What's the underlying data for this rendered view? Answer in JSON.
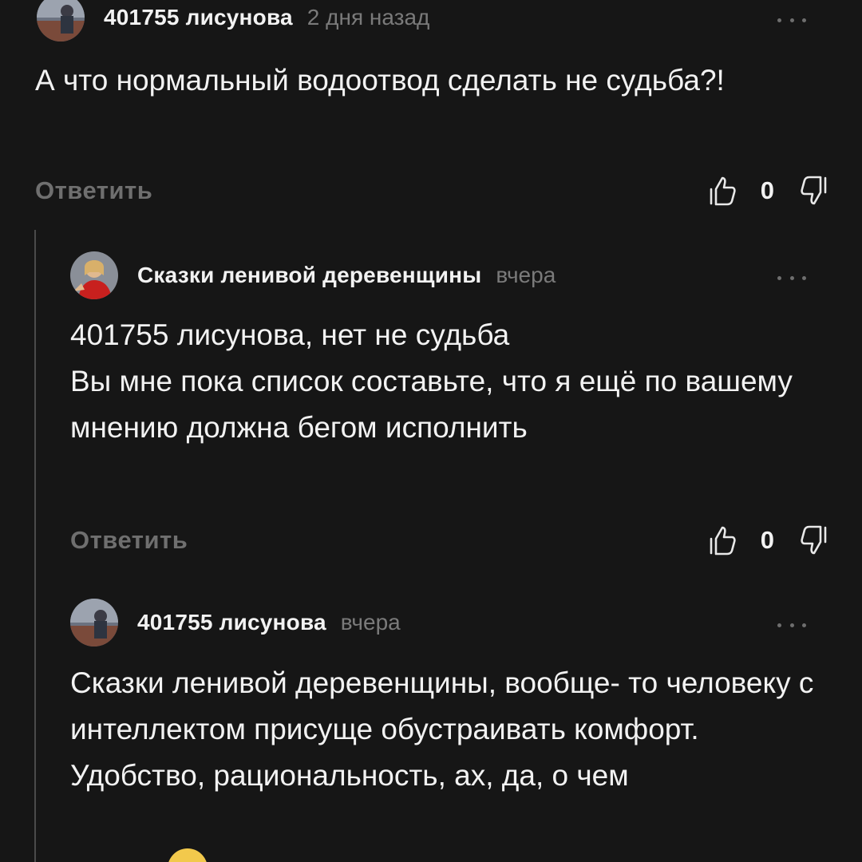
{
  "comments": [
    {
      "author": "401755 лисунова",
      "time": "2 дня назад",
      "text": "А что нормальный водоотвод сделать не судьба?!",
      "reply_label": "Ответить",
      "score": "0",
      "avatar_icon": "user-photo-avatar"
    },
    {
      "author": "Сказки ленивой деревенщины",
      "time": "вчера",
      "text": "401755 лисунова, нет не судьба\nВы мне пока список составьте, что я ещё по вашему мнению должна бегом исполнить",
      "reply_label": "Ответить",
      "score": "0",
      "avatar_icon": "user-photo-avatar"
    },
    {
      "author": "401755 лисунова",
      "time": "вчера",
      "text": "Сказки ленивой деревенщины, вообще- то человеку с интеллектом присуще обустраивать комфорт.\nУдобство, рациональность, ах, да, о чем",
      "avatar_icon": "user-photo-avatar"
    }
  ],
  "icons": {
    "like": "thumbs-up-icon",
    "dislike": "thumbs-down-icon",
    "more": "more-dots-icon"
  },
  "colors": {
    "background": "#161616",
    "text": "#f2f2f2",
    "muted": "#7a7a7a",
    "thread_line": "#4a4a4a"
  }
}
